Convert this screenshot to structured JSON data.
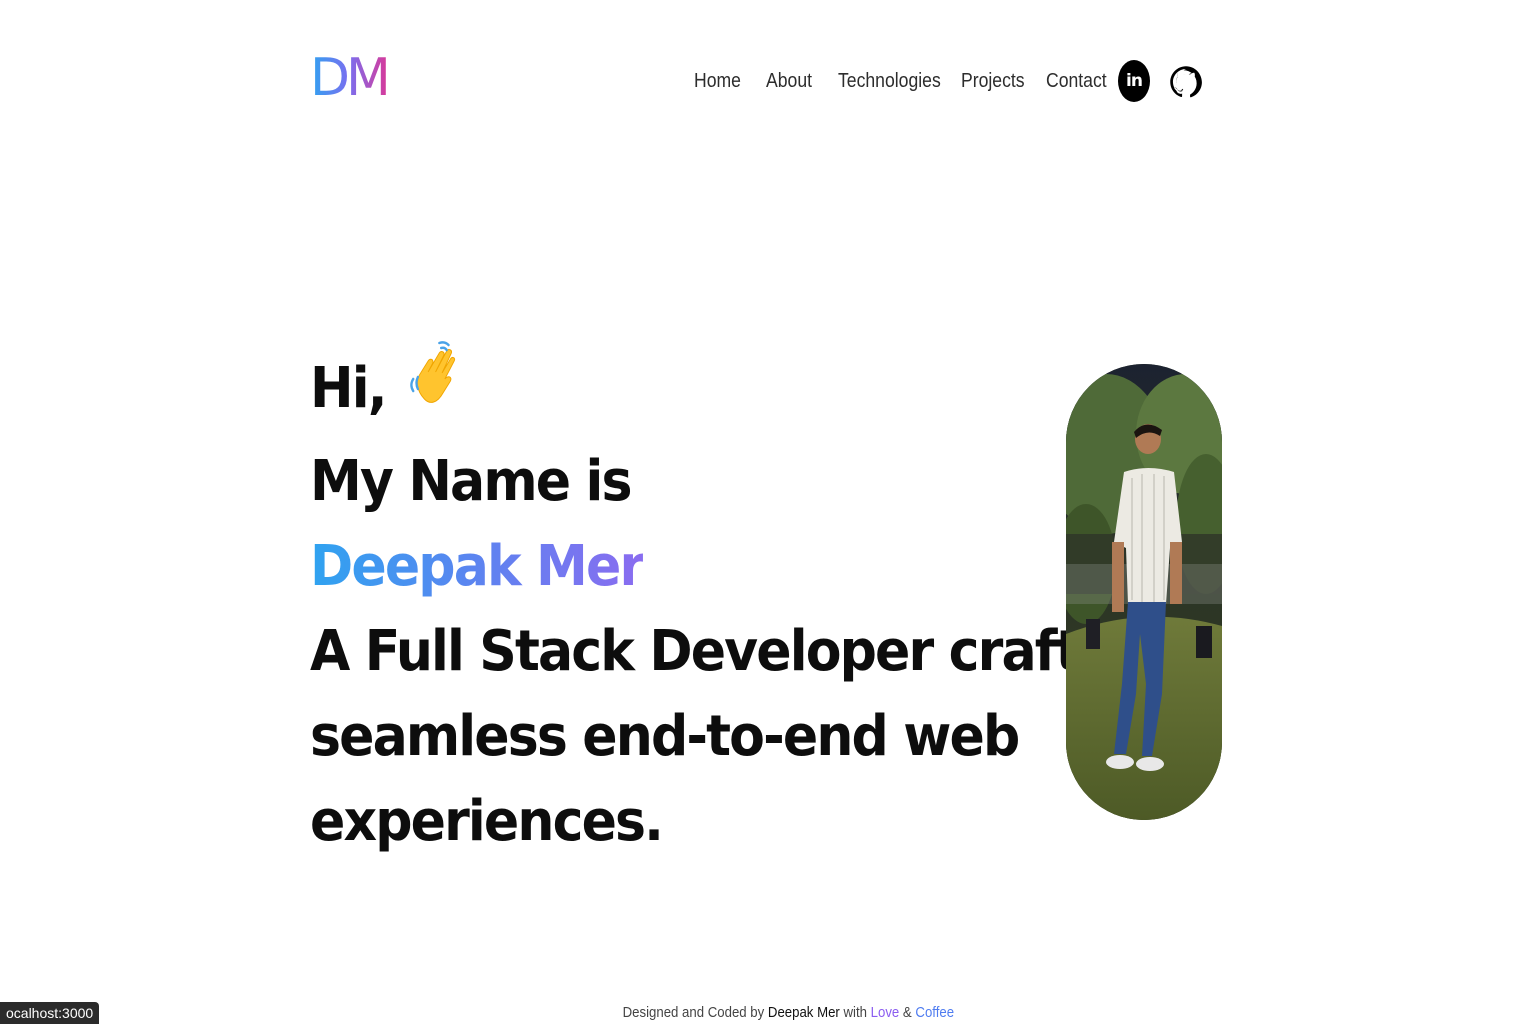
{
  "header": {
    "logo": "DM",
    "nav": [
      {
        "label": "Home"
      },
      {
        "label": "About"
      },
      {
        "label": "Technologies"
      },
      {
        "label": "Projects"
      },
      {
        "label": "Contact"
      }
    ],
    "social": [
      {
        "icon": "linkedin-icon",
        "glyph": "in"
      },
      {
        "icon": "github-icon"
      }
    ]
  },
  "hero": {
    "greeting": "Hi,",
    "greeting_icon": "waving-hand-emoji",
    "intro": "My Name is",
    "name": "Deepak Mer",
    "tagline_lines": [
      "A Full Stack Developer crafting",
      "seamless end-to-end web",
      "experiences."
    ]
  },
  "photo": {
    "icon": "profile-photo"
  },
  "footer": {
    "prefix": "Designed and Coded by",
    "author": "Deepak Mer",
    "middle": "with",
    "love": "Love",
    "amp": "&",
    "coffee": "Coffee"
  },
  "status_bar": {
    "url": "ocalhost:3000"
  },
  "colors": {
    "gradient_start": "#2fa3f0",
    "gradient_mid": "#7a6ff0",
    "gradient_end": "#d63a9b",
    "text": "#0d0d0d"
  }
}
